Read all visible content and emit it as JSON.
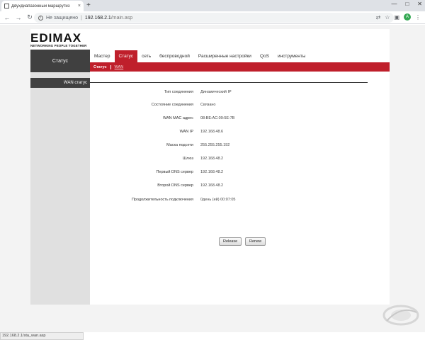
{
  "browser": {
    "tab_title": "Двухдиапазонный маршрутиз",
    "tab_close": "×",
    "new_tab": "+",
    "security_label": "Не защищено",
    "separator": "|",
    "url_host": "192.168.2.1",
    "url_path": "/main.asp",
    "avatar_letter": "A",
    "status_url": "192.168.2.1/sta_wan.asp"
  },
  "router": {
    "logo_text": "EDIMAX",
    "logo_tagline": "NETWORKING PEOPLE TOGETHER",
    "status_box": "Статус",
    "nav": [
      {
        "label": "Мастер"
      },
      {
        "label": "Статус"
      },
      {
        "label": "сеть"
      },
      {
        "label": "беспроводной"
      },
      {
        "label": "Расширенные настройки"
      },
      {
        "label": "QoS"
      },
      {
        "label": "инструменты"
      }
    ],
    "subnav": [
      {
        "label": "Статус"
      },
      {
        "label": "WAN"
      }
    ],
    "sidebar_header": "WAN статус",
    "rows": [
      {
        "label": "Тип соединения",
        "value": "Динамический IP"
      },
      {
        "label": "Состояние соединения",
        "value": "Связано"
      },
      {
        "label": "WAN MAC адрес",
        "value": "08:BE:AC:09:5E:7B"
      },
      {
        "label": "WAN IP",
        "value": "192.168.48.6"
      },
      {
        "label": "Маска подсети",
        "value": "255.255.255.192"
      },
      {
        "label": "Шлюз",
        "value": "192.168.48.2"
      },
      {
        "label": "Первый DNS сервер",
        "value": "192.168.48.2"
      },
      {
        "label": "Второй DNS сервер",
        "value": "192.168.48.2"
      },
      {
        "label": "Продолжительность подключения",
        "value": "0день (ей) 00:07:05"
      }
    ],
    "buttons": {
      "release": "Release",
      "renew": "Renew"
    }
  },
  "colors": {
    "accent_red": "#bf1f2b",
    "dark_gray": "#404040"
  }
}
